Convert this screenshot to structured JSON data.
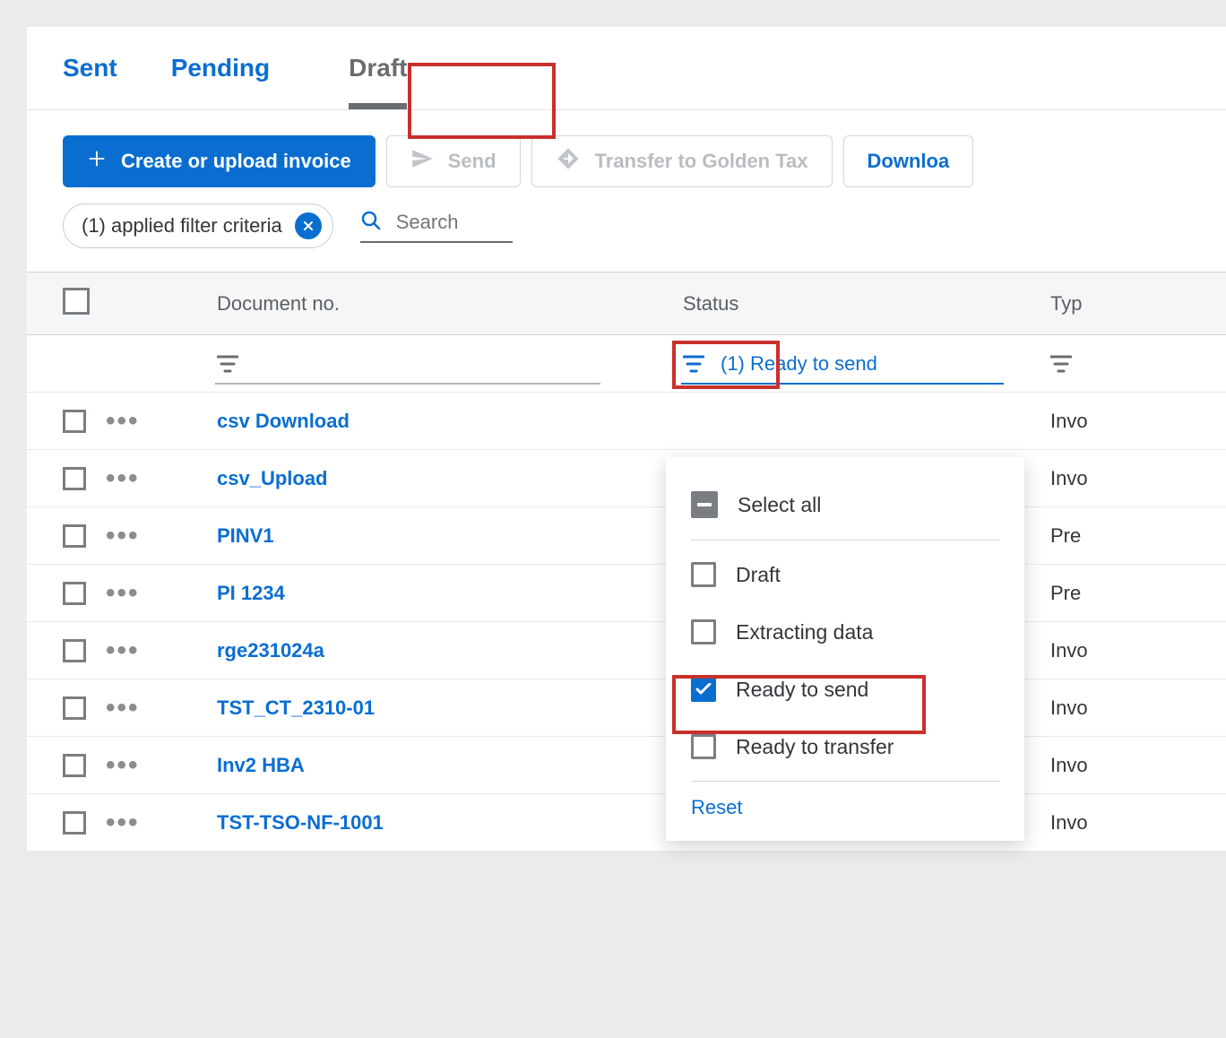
{
  "tabs": {
    "sent": "Sent",
    "pending": "Pending",
    "draft": "Draft"
  },
  "toolbar": {
    "create": "Create or upload invoice",
    "send": "Send",
    "transfer": "Transfer to Golden Tax",
    "download": "Downloa"
  },
  "filter_chip": {
    "label": "(1) applied filter criteria"
  },
  "search": {
    "placeholder": "Search"
  },
  "columns": {
    "doc": "Document no.",
    "status": "Status",
    "type": "Typ"
  },
  "status_filter_label": "(1) Ready to send",
  "dropdown": {
    "select_all": "Select all",
    "options": [
      {
        "label": "Draft",
        "checked": false
      },
      {
        "label": "Extracting data",
        "checked": false
      },
      {
        "label": "Ready to send",
        "checked": true
      },
      {
        "label": "Ready to transfer",
        "checked": false
      }
    ],
    "reset": "Reset"
  },
  "status_under_text": "Ready to send",
  "rows": [
    {
      "doc": "csv Download",
      "type": "Invo"
    },
    {
      "doc": "csv_Upload",
      "type": "Invo"
    },
    {
      "doc": "PINV1",
      "type": "Pre"
    },
    {
      "doc": "PI 1234",
      "type": "Pre"
    },
    {
      "doc": "rge231024a",
      "type": "Invo"
    },
    {
      "doc": "TST_CT_2310-01",
      "type": "Invo"
    },
    {
      "doc": "Inv2 HBA",
      "type": "Invo"
    },
    {
      "doc": "TST-TSO-NF-1001",
      "type": "Invo"
    }
  ]
}
